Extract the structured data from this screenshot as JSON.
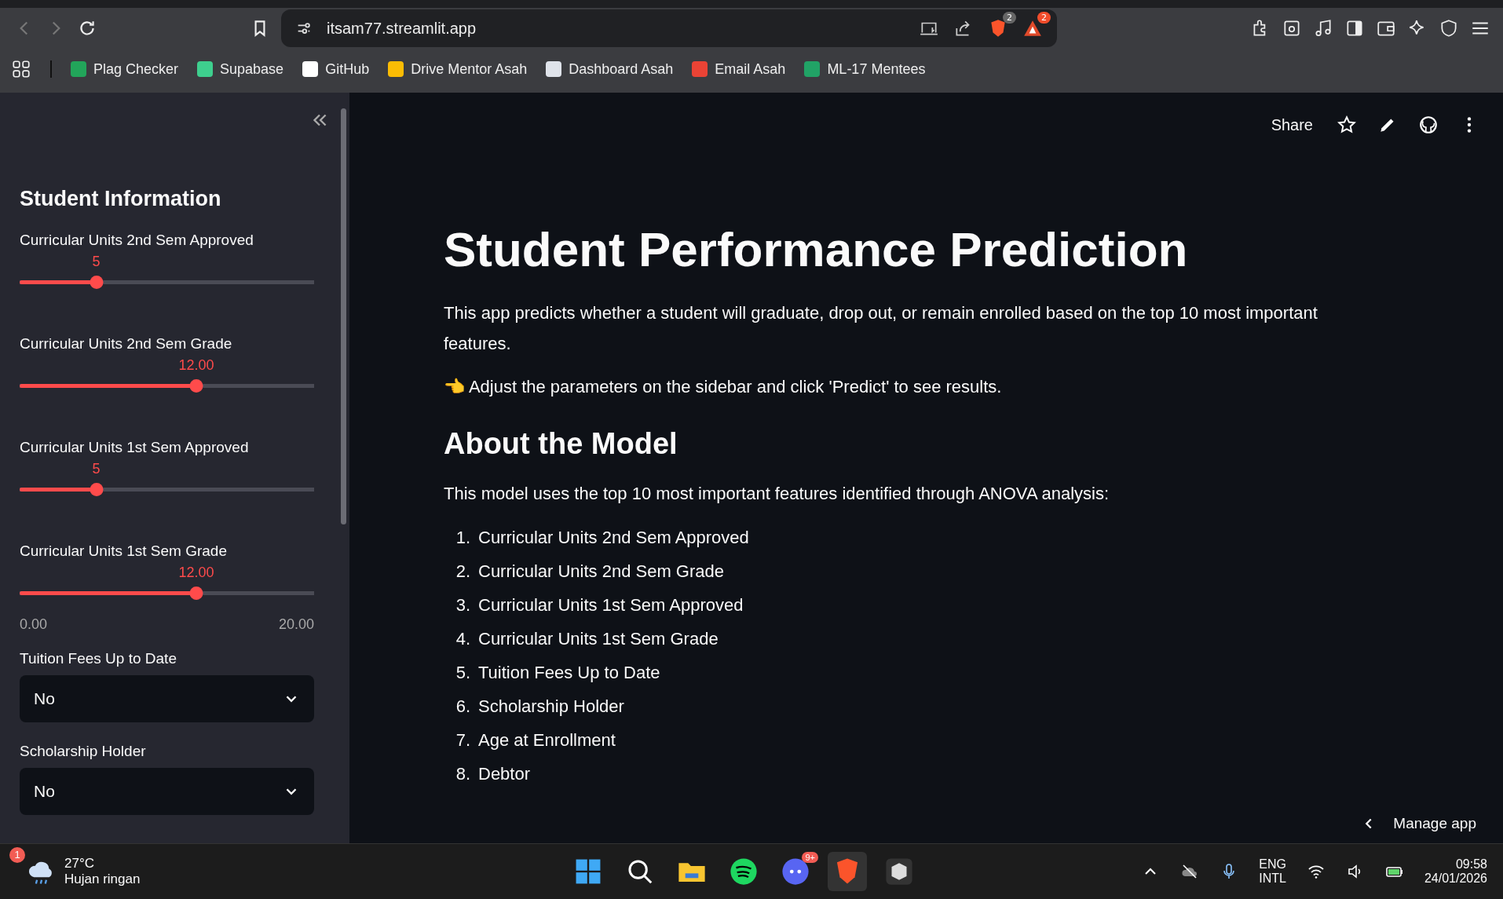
{
  "browser": {
    "url": "itsam77.streamlit.app",
    "shield_badge": "2",
    "rewards_badge": "2",
    "bookmarks": [
      {
        "label": "Plag Checker",
        "color": "#22a55a"
      },
      {
        "label": "Supabase",
        "color": "#3ecf8e"
      },
      {
        "label": "GitHub",
        "color": "#ffffff"
      },
      {
        "label": "Drive Mentor Asah",
        "color": "#fbbc04"
      },
      {
        "label": "Dashboard Asah",
        "color": "#dfe3ea"
      },
      {
        "label": "Email Asah",
        "color": "#ea4335"
      },
      {
        "label": "ML-17 Mentees",
        "color": "#21a366"
      }
    ]
  },
  "sidebar": {
    "title": "Student Information",
    "min_label": "0.00",
    "max_label": "20.00",
    "sliders": [
      {
        "label": "Curricular Units 2nd Sem Approved",
        "value": "5",
        "level": 0.26
      },
      {
        "label": "Curricular Units 2nd Sem Grade",
        "value": "12.00",
        "level": 0.6
      },
      {
        "label": "Curricular Units 1st Sem Approved",
        "value": "5",
        "level": 0.26
      },
      {
        "label": "Curricular Units 1st Sem Grade",
        "value": "12.00",
        "level": 0.6
      }
    ],
    "selects": [
      {
        "label": "Tuition Fees Up to Date",
        "value": "No"
      },
      {
        "label": "Scholarship Holder",
        "value": "No"
      }
    ]
  },
  "toolbar": {
    "share": "Share"
  },
  "main": {
    "title": "Student Performance Prediction",
    "intro": "This app predicts whether a student will graduate, drop out, or remain enrolled based on the top 10 most important features.",
    "hint": "👈 Adjust the parameters on the sidebar and click 'Predict' to see results.",
    "about_title": "About the Model",
    "about_text": "This model uses the top 10 most important features identified through ANOVA analysis:",
    "features": [
      {
        "number": "1.",
        "text": "Curricular Units 2nd Sem Approved"
      },
      {
        "number": "2.",
        "text": "Curricular Units 2nd Sem Grade"
      },
      {
        "number": "3.",
        "text": "Curricular Units 1st Sem Approved"
      },
      {
        "number": "4.",
        "text": "Curricular Units 1st Sem Grade"
      },
      {
        "number": "5.",
        "text": "Tuition Fees Up to Date"
      },
      {
        "number": "6.",
        "text": "Scholarship Holder"
      },
      {
        "number": "7.",
        "text": "Age at Enrollment"
      },
      {
        "number": "8.",
        "text": "Debtor"
      }
    ]
  },
  "manage_app": "Manage app",
  "taskbar": {
    "weather_badge": "1",
    "temperature": "27°C",
    "condition": "Hujan ringan",
    "discord_badge": "9+",
    "language": "ENG",
    "layout": "INTL",
    "time": "09:58",
    "date": "24/01/2026"
  }
}
